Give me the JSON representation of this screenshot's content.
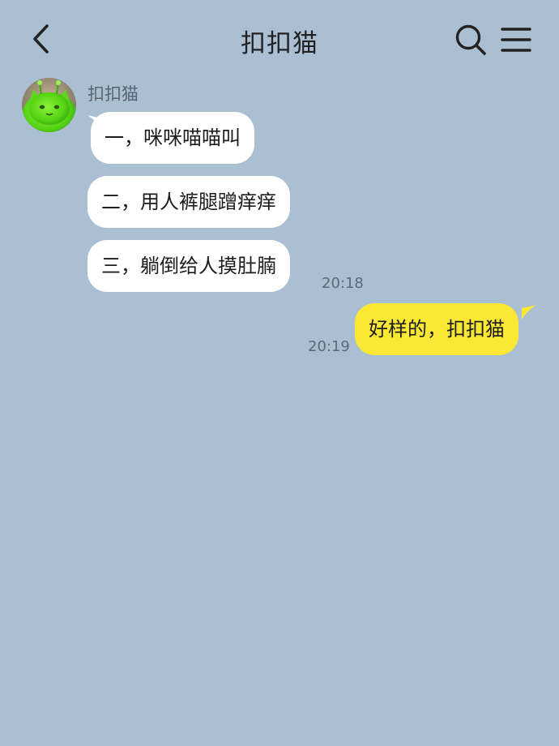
{
  "header": {
    "title": "扣扣猫"
  },
  "contact": {
    "name": "扣扣猫"
  },
  "messages": [
    {
      "direction": "incoming",
      "text": "一，咪咪喵喵叫"
    },
    {
      "direction": "incoming",
      "text": "二，用人裤腿蹭痒痒"
    },
    {
      "direction": "incoming",
      "text": "三，躺倒给人摸肚腩",
      "time": "20:18"
    },
    {
      "direction": "outgoing",
      "text": "好样的，扣扣猫",
      "time": "20:19"
    }
  ],
  "colors": {
    "background": "#aabfd2",
    "incoming_bubble": "#ffffff",
    "outgoing_bubble": "#fbe834"
  },
  "icons": {
    "back": "chevron-left-icon",
    "search": "search-icon",
    "menu": "menu-icon"
  }
}
